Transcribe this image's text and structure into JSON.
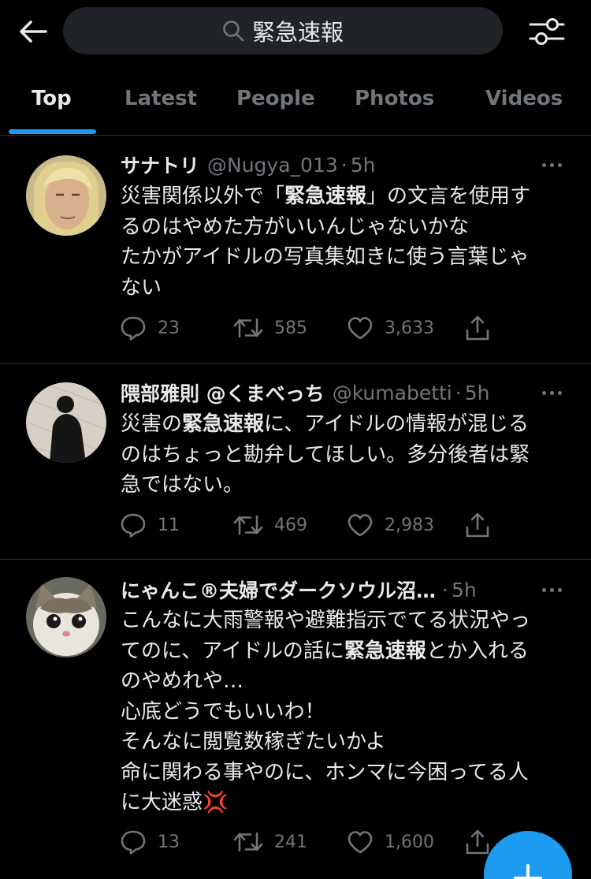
{
  "search": {
    "query": "緊急速報"
  },
  "tabs": [
    "Top",
    "Latest",
    "People",
    "Photos",
    "Videos"
  ],
  "tweets": [
    {
      "name": "サナトリ",
      "handle": "@Nugya_013",
      "time": "5h",
      "lines": [
        [
          "災害関係以外で「",
          "緊急速報",
          "」の文言を使用す"
        ],
        [
          "るのはやめた方がいいんじゃないかな"
        ],
        [
          "たかがアイドルの写真集如きに使う言葉じゃ"
        ],
        [
          "ない"
        ]
      ],
      "replies": "23",
      "retweets": "585",
      "likes": "3,633"
    },
    {
      "name": "隈部雅則 @くまべっち",
      "handle": "@kumabetti",
      "time": "5h",
      "lines": [
        [
          "災害の",
          "緊急速報",
          "に、アイドルの情報が混じる"
        ],
        [
          "のはちょっと勘弁してほしい。多分後者は緊"
        ],
        [
          "急ではない。"
        ]
      ],
      "replies": "11",
      "retweets": "469",
      "likes": "2,983"
    },
    {
      "name": "にゃんこ®夫婦でダークソウル沼…",
      "handle": "",
      "time": "5h",
      "lines": [
        [
          "こんなに大雨警報や避難指示でてる状況やっ"
        ],
        [
          "てのに、アイドルの話に",
          "緊急速報",
          "とか入れる"
        ],
        [
          "のやめれや…"
        ],
        [
          "心底どうでもいいわ！"
        ],
        [
          "そんなに閲覧数稼ぎたいかよ"
        ],
        [
          "命に関わる事やのに、ホンマに今困ってる人"
        ],
        [
          "に大迷惑💢"
        ]
      ],
      "replies": "13",
      "retweets": "241",
      "likes": "1,600"
    }
  ],
  "colors": {
    "accent": "#1d9bf0",
    "muted": "#71767b",
    "text": "#e7e9ea",
    "divider": "#2f3336"
  }
}
